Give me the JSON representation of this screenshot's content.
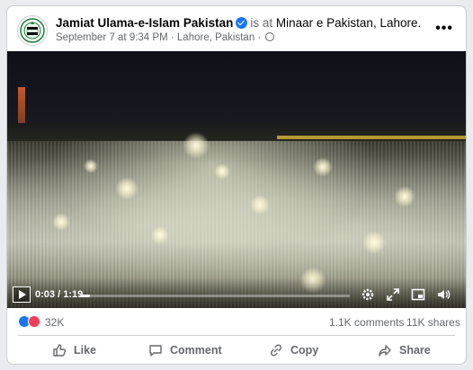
{
  "post": {
    "author": "Jamiat Ulama-e-Islam Pakistan",
    "verified_icon": "verified-badge-icon",
    "is_at_text": "is at",
    "location_name": "Minaar e Pakistan, Lahore.",
    "timestamp": "September 7 at 9:34 PM",
    "separator": "·",
    "city": "Lahore, Pakistan",
    "city_separator": "·",
    "audience_icon": "globe-icon",
    "more_label": "•••"
  },
  "video": {
    "current_time": "0:03",
    "time_separator": "/",
    "duration": "1:19",
    "progress_fraction": 0.038,
    "controls": [
      "play-icon",
      "settings-icon",
      "fullscreen-icon",
      "pip-icon",
      "volume-icon"
    ]
  },
  "reactions": {
    "count": "32K",
    "icons": [
      "like-reaction-icon",
      "love-reaction-icon"
    ],
    "comments": "1.1K comments",
    "shares": "11K shares"
  },
  "actions": {
    "like": "Like",
    "comment": "Comment",
    "copy": "Copy",
    "share": "Share"
  },
  "colors": {
    "brand_blue": "#1877f2",
    "love_red": "#f33e58",
    "secondary_text": "#65676b"
  }
}
